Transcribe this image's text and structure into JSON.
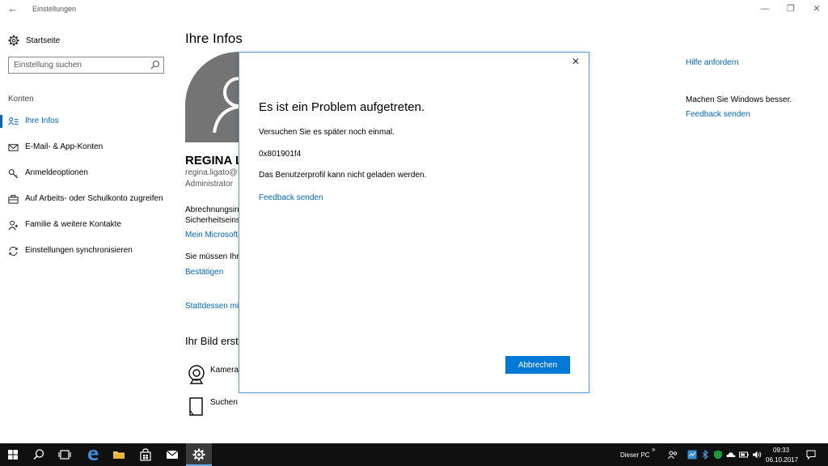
{
  "window": {
    "title": "Einstellungen",
    "controls": {
      "minimize": "—",
      "restore": "❐",
      "close": "✕"
    }
  },
  "sidebar": {
    "home_label": "Startseite",
    "search_placeholder": "Einstellung suchen",
    "section_label": "Konten",
    "items": [
      {
        "label": "Ihre Infos",
        "icon": "person-card-icon",
        "active": true
      },
      {
        "label": "E-Mail- & App-Konten",
        "icon": "mail-icon",
        "active": false
      },
      {
        "label": "Anmeldeoptionen",
        "icon": "key-icon",
        "active": false
      },
      {
        "label": "Auf Arbeits- oder Schulkonto zugreifen",
        "icon": "briefcase-icon",
        "active": false
      },
      {
        "label": "Familie & weitere Kontakte",
        "icon": "person-add-icon",
        "active": false
      },
      {
        "label": "Einstellungen synchronisieren",
        "icon": "sync-icon",
        "active": false
      }
    ]
  },
  "main": {
    "title": "Ihre Infos",
    "user_name": "REGINA L",
    "user_email": "regina.ligato@",
    "user_role": "Administrator",
    "billing_line1": "Abrechnungsin",
    "billing_line2": "Sicherheitseins",
    "ms_account_link": "Mein Microsoft",
    "must_text": "Sie müssen Ihre",
    "confirm_link": "Bestätigen",
    "instead_link": "Stattdessen mit",
    "picture_heading": "Ihr Bild erst",
    "picture_options": [
      {
        "label": "Kamera",
        "icon": "webcam-icon"
      },
      {
        "label": "Suchen",
        "icon": "browse-file-icon"
      }
    ]
  },
  "right_col": {
    "help_link": "Hilfe anfordern",
    "improve_text": "Machen Sie Windows besser.",
    "feedback_link": "Feedback senden"
  },
  "dialog": {
    "title": "Es ist ein Problem aufgetreten.",
    "message": "Versuchen Sie es später noch einmal.",
    "error_code": "0x801901f4",
    "detail": "Das Benutzerprofil kann nicht geladen werden.",
    "feedback_link": "Feedback senden",
    "cancel_label": "Abbrechen"
  },
  "taskbar": {
    "this_pc_label": "Dieser PC",
    "time": "09:33",
    "date": "06.10.2017"
  },
  "colors": {
    "accent": "#0067c0",
    "button": "#0078d7",
    "taskbar": "#101010",
    "avatar": "#747474"
  }
}
